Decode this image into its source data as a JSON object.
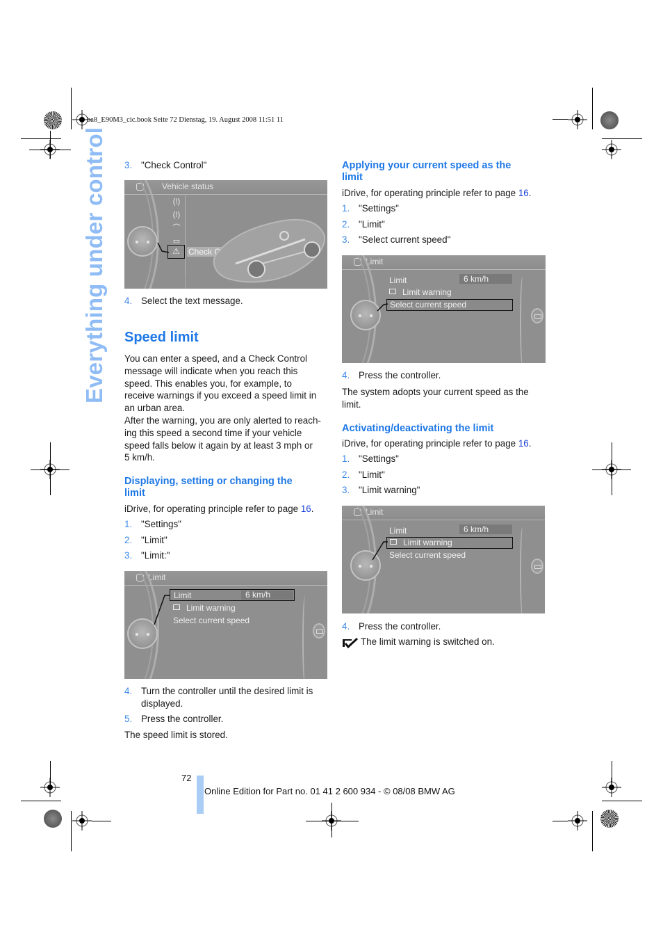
{
  "print_slug": "ba8_E90M3_cic.book  Seite 72  Dienstag, 19. August 2008  11:51 11",
  "side_title": "Everything under control",
  "left_column": {
    "step3_num": "3.",
    "step3_text": "\"Check Control\"",
    "vehicle_status_screen": {
      "title": "Vehicle status",
      "icons": [
        "tire-pressure-icon",
        "tire-pressure-warning-icon",
        "oil-level-icon",
        "car-icon",
        "warning-triangle-icon"
      ],
      "selected_label": "Check Control"
    },
    "step4_num": "4.",
    "step4_text": "Select the text message.",
    "section_title": "Speed limit",
    "intro_lines": [
      "You can enter a speed, and a Check Control",
      "message will indicate when you reach this",
      "speed. This enables you, for example, to",
      "receive warnings if you exceed a speed limit in",
      "an urban area.",
      "After the warning, you are only alerted to reach-",
      "ing this speed a second time if your vehicle",
      "speed falls below it again by at least 3 mph or",
      "5 km/h."
    ],
    "sub1": {
      "title_line1": "Displaying, setting or changing the",
      "title_line2": "limit",
      "idrive_prefix": "iDrive, for operating principle refer to page ",
      "idrive_page": "16",
      "idrive_suffix": ".",
      "steps": [
        {
          "num": "1.",
          "text": "\"Settings\""
        },
        {
          "num": "2.",
          "text": "\"Limit\""
        },
        {
          "num": "3.",
          "text": "\"Limit:\""
        }
      ],
      "screen": {
        "title": "Limit",
        "limit_label": "Limit",
        "limit_value": "6 km/h",
        "warning_label": "Limit warning",
        "current_speed_label": "Select current speed",
        "selected": "Limit"
      },
      "after_steps": [
        {
          "num": "4.",
          "text": "Turn the controller until the desired limit is",
          "text2": "displayed."
        },
        {
          "num": "5.",
          "text": "Press the controller."
        }
      ],
      "result": "The speed limit is stored."
    }
  },
  "right_column": {
    "sub2": {
      "title_line1": "Applying your current speed as the",
      "title_line2": "limit",
      "idrive_prefix": "iDrive, for operating principle refer to page ",
      "idrive_page": "16",
      "idrive_suffix": ".",
      "steps": [
        {
          "num": "1.",
          "text": "\"Settings\""
        },
        {
          "num": "2.",
          "text": "\"Limit\""
        },
        {
          "num": "3.",
          "text": "\"Select current speed\""
        }
      ],
      "screen": {
        "title": "Limit",
        "limit_label": "Limit",
        "limit_value": "6 km/h",
        "warning_label": "Limit warning",
        "current_speed_label": "Select current speed",
        "selected": "Select current speed"
      },
      "step4_num": "4.",
      "step4_text": "Press the controller.",
      "result_line1": "The system adopts your current speed as the",
      "result_line2": "limit."
    },
    "sub3": {
      "title": "Activating/deactivating the limit",
      "idrive_prefix": "iDrive, for operating principle refer to page ",
      "idrive_page": "16",
      "idrive_suffix": ".",
      "steps": [
        {
          "num": "1.",
          "text": "\"Settings\""
        },
        {
          "num": "2.",
          "text": "\"Limit\""
        },
        {
          "num": "3.",
          "text": "\"Limit warning\""
        }
      ],
      "screen": {
        "title": "Limit",
        "limit_label": "Limit",
        "limit_value": "6 km/h",
        "warning_label": "Limit warning",
        "current_speed_label": "Select current speed",
        "selected": "Limit warning"
      },
      "step4_num": "4.",
      "step4_text": "Press the controller.",
      "note": "The limit warning is switched on."
    }
  },
  "footer": {
    "page_number": "72",
    "edition": "Online Edition for Part no. 01 41 2 600 934 - © 08/08 BMW AG"
  },
  "colors": {
    "heading_blue": "#1e78e6",
    "step_number_blue": "#3a88e6",
    "link_blue": "#1a3fd6",
    "side_title_blue": "#8fbcf5",
    "footer_bar": "#a9cdf5",
    "screen_grey": "#8f8f8f"
  }
}
